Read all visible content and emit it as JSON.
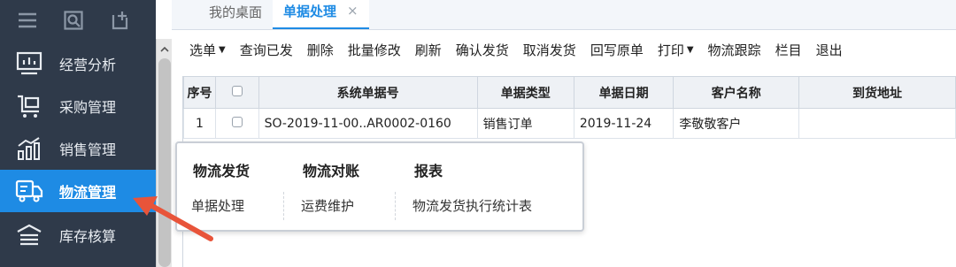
{
  "sidebar": {
    "top_icons": [
      "menu-icon",
      "search-doc-icon",
      "add-window-icon"
    ],
    "items": [
      {
        "label": "经营分析",
        "icon": "monitor-chart-icon",
        "active": false
      },
      {
        "label": "采购管理",
        "icon": "cart-icon",
        "active": false
      },
      {
        "label": "销售管理",
        "icon": "bar-trend-icon",
        "active": false
      },
      {
        "label": "物流管理",
        "icon": "truck-icon",
        "active": true
      },
      {
        "label": "库存核算",
        "icon": "warehouse-icon",
        "active": false
      }
    ]
  },
  "tabs": [
    {
      "label": "我的桌面",
      "active": false
    },
    {
      "label": "单据处理",
      "active": true,
      "close": "×"
    }
  ],
  "toolbar": {
    "items": [
      "选单",
      "查询已发",
      "删除",
      "批量修改",
      "刷新",
      "确认发货",
      "取消发货",
      "回写原单",
      "打印",
      "物流跟踪",
      "栏目",
      "退出"
    ],
    "dropdowns": [
      "选单",
      "打印"
    ]
  },
  "table": {
    "columns": [
      "序号",
      "",
      "系统单据号",
      "单据类型",
      "单据日期",
      "客户名称",
      "到货地址"
    ],
    "rows": [
      [
        "1",
        "",
        "SO-2019-11-00..AR0002-0160",
        "销售订单",
        "2019-11-24",
        "李敬敬客户",
        ""
      ]
    ]
  },
  "popup": {
    "groups": [
      {
        "heading": "物流发货",
        "items": [
          "单据处理"
        ]
      },
      {
        "heading": "物流对账",
        "items": [
          "运费维护"
        ]
      },
      {
        "heading": "报表",
        "items": [
          "物流发货执行统计表"
        ]
      }
    ]
  },
  "colors": {
    "sidebar_bg": "#2f3a4a",
    "active_bg": "#1e8be4",
    "accent": "#1e8be4",
    "arrow": "#e8543a"
  }
}
